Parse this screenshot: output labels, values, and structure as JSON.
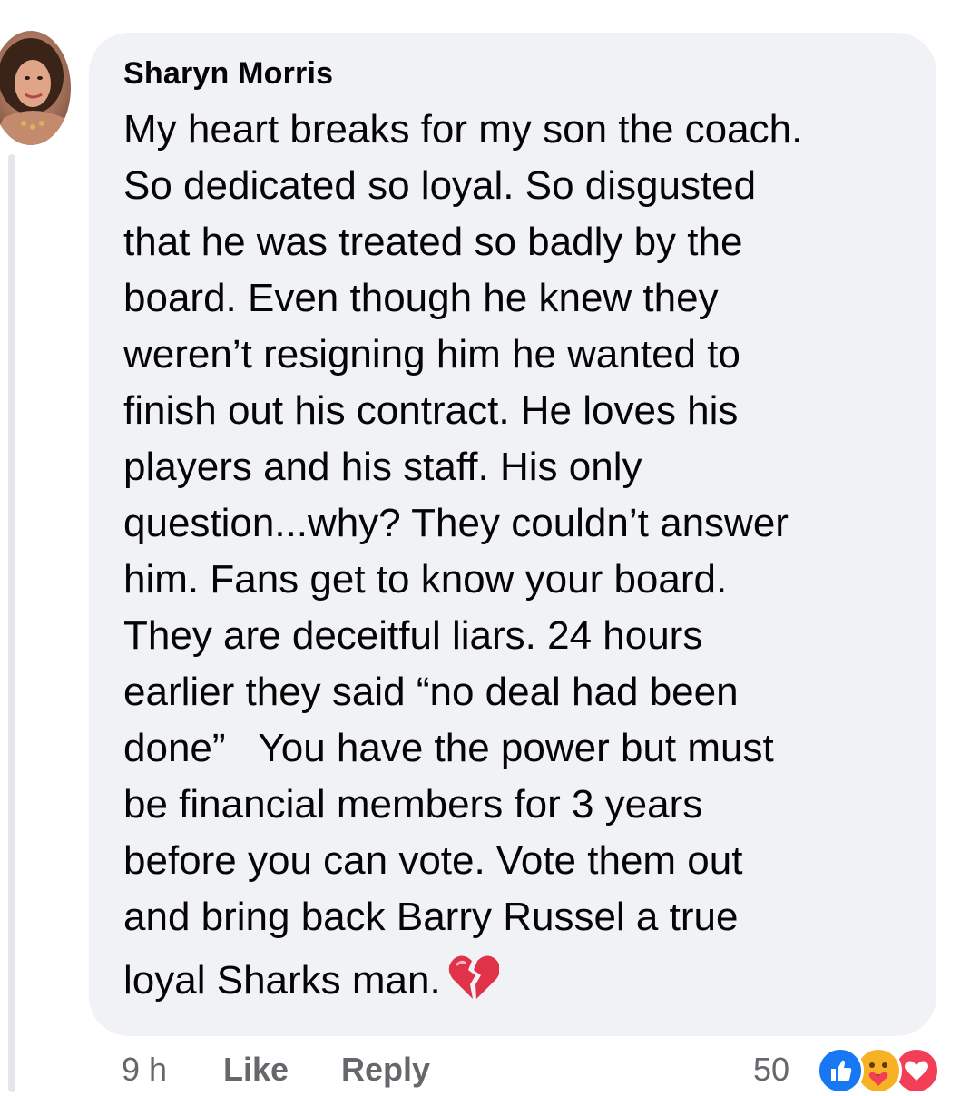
{
  "comment": {
    "author": "Sharyn Morris",
    "lines": [
      "My heart breaks for my son the coach.",
      "So dedicated so loyal. So disgusted",
      "that he was treated so badly by the",
      "board. Even though he knew they",
      "weren’t resigning him he wanted to",
      "finish out his contract. He loves his",
      "players and his staff. His only",
      "question...why? They couldn’t answer",
      "him. Fans get to know your board.",
      "They are deceitful liars. 24 hours",
      "earlier they said “no deal had been",
      "done”   You have the power but must",
      "be financial members for 3 years",
      "before you can vote. Vote them out",
      "and bring back Barry Russel a true",
      "loyal Sharks man."
    ],
    "emoji": "broken-heart-icon",
    "timestamp": "9 h",
    "like_label": "Like",
    "reply_label": "Reply",
    "reaction_count": "50",
    "reactions": [
      "like-reaction-icon",
      "care-reaction-icon",
      "love-reaction-icon"
    ]
  },
  "colors": {
    "bubble": "#f0f2f5",
    "text": "#050505",
    "secondary_text": "#65676b",
    "like_blue": "#1877f2",
    "love_red": "#f33e58",
    "care_yellow": "#f7b125",
    "broken_heart": "#e0334a"
  }
}
